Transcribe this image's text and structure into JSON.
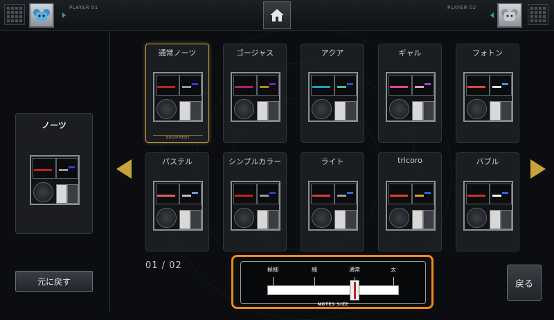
{
  "header": {
    "player1_label": "PLAYER 01",
    "player2_label": "PLAYER 02"
  },
  "current_skin_panel": {
    "title": "ノーツ",
    "note_colors": [
      "#c02020",
      "#9a9a9a",
      "#2a3fd6"
    ]
  },
  "skins": [
    {
      "label": "通常ノーツ",
      "selected": true,
      "colors": [
        "#c02020",
        "#9a9a9a",
        "#2a3fd6"
      ]
    },
    {
      "label": "ゴージャス",
      "selected": false,
      "colors": [
        "#b02070",
        "#b08a20",
        "#7020c0"
      ]
    },
    {
      "label": "アクア",
      "selected": false,
      "colors": [
        "#1aa0c0",
        "#40c0a0",
        "#2050e0"
      ]
    },
    {
      "label": "ギャル",
      "selected": false,
      "colors": [
        "#e0409a",
        "#e09ac0",
        "#9a40e0"
      ]
    },
    {
      "label": "フォトン",
      "selected": false,
      "colors": [
        "#e04040",
        "#e0e0e0",
        "#4090ff"
      ]
    },
    {
      "label": "パステル",
      "selected": false,
      "colors": [
        "#e06060",
        "#c0c0c0",
        "#7090e0"
      ]
    },
    {
      "label": "シンプルカラー",
      "selected": false,
      "colors": [
        "#d02020",
        "#9a9a9a",
        "#2040d0"
      ]
    },
    {
      "label": "ライト",
      "selected": false,
      "colors": [
        "#e03a3a",
        "#a0a0a0",
        "#3a60e0"
      ]
    },
    {
      "label": "tricoro",
      "selected": false,
      "colors": [
        "#e04020",
        "#e0a020",
        "#3060e0"
      ]
    },
    {
      "label": "バブル",
      "selected": false,
      "colors": [
        "#d03030",
        "#ffffff",
        "#3060e0"
      ]
    }
  ],
  "equipment_label": "EQUIPMENT",
  "page_indicator": "01 / 02",
  "reset_button_label": "元に戻す",
  "back_button_label": "戻る",
  "notes_size": {
    "label": "NOTES SIZE",
    "ticks": [
      "極細",
      "細",
      "通常",
      "太"
    ],
    "selected_index": 2
  },
  "colors": {
    "accent_gold": "#c7a437",
    "highlight_orange": "#f08a1c"
  }
}
